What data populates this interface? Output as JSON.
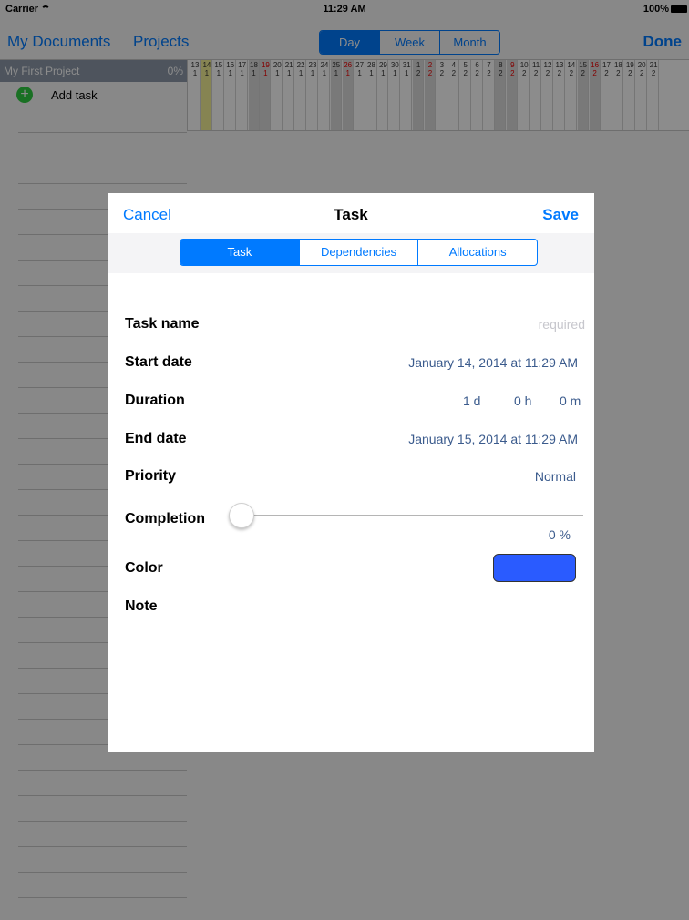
{
  "status": {
    "carrier": "Carrier",
    "time": "11:29 AM",
    "battery": "100%"
  },
  "nav": {
    "my_documents": "My Documents",
    "projects": "Projects",
    "done": "Done",
    "view_modes": [
      "Day",
      "Week",
      "Month"
    ],
    "active_view": "Day"
  },
  "project": {
    "name": "My First Project",
    "completion": "0%",
    "add_task": "Add task"
  },
  "timeline": {
    "days": [
      "13",
      "14",
      "15",
      "16",
      "17",
      "18",
      "19",
      "20",
      "21",
      "22",
      "23",
      "24",
      "25",
      "26",
      "27",
      "28",
      "29",
      "30",
      "31",
      "1",
      "2",
      "3",
      "4",
      "5",
      "6",
      "7",
      "8",
      "9",
      "10",
      "11",
      "12",
      "13",
      "14",
      "15",
      "16",
      "17",
      "18",
      "19",
      "20",
      "21"
    ],
    "months": [
      "1",
      "1",
      "1",
      "1",
      "1",
      "1",
      "1",
      "1",
      "1",
      "1",
      "1",
      "1",
      "1",
      "1",
      "1",
      "1",
      "1",
      "1",
      "1",
      "2",
      "2",
      "2",
      "2",
      "2",
      "2",
      "2",
      "2",
      "2",
      "2",
      "2",
      "2",
      "2",
      "2",
      "2",
      "2",
      "2",
      "2",
      "2",
      "2",
      "2"
    ],
    "red_columns": [
      6,
      13,
      20,
      27,
      34
    ],
    "weekend_columns": [
      5,
      6,
      12,
      13,
      19,
      20,
      26,
      27,
      33,
      34
    ],
    "today_column": 1
  },
  "modal": {
    "cancel": "Cancel",
    "title": "Task",
    "save": "Save",
    "tabs": [
      "Task",
      "Dependencies",
      "Allocations"
    ],
    "active_tab": "Task",
    "fields": {
      "task_name_label": "Task name",
      "task_name_placeholder": "required",
      "start_date_label": "Start date",
      "start_date_value": "January 14, 2014 at 11:29 AM",
      "duration_label": "Duration",
      "duration_days": "1 d",
      "duration_hours": "0 h",
      "duration_minutes": "0 m",
      "end_date_label": "End date",
      "end_date_value": "January 15, 2014 at 11:29 AM",
      "priority_label": "Priority",
      "priority_value": "Normal",
      "completion_label": "Completion",
      "completion_value": "0 %",
      "completion_fraction": 0,
      "color_label": "Color",
      "color_value": "#2a5bff",
      "note_label": "Note"
    }
  }
}
